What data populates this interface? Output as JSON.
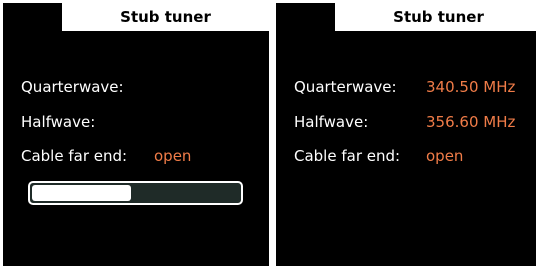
{
  "panels": [
    {
      "title": "Stub tuner",
      "rows": [
        {
          "label": "Quarterwave:",
          "value": ""
        },
        {
          "label": "Halfwave:",
          "value": ""
        },
        {
          "label": "Cable far end:",
          "value": "open"
        }
      ],
      "progress": 0.48
    },
    {
      "title": "Stub tuner",
      "rows": [
        {
          "label": "Quarterwave:",
          "value": "340.50 MHz"
        },
        {
          "label": "Halfwave:",
          "value": "356.60 MHz"
        },
        {
          "label": "Cable far end:",
          "value": "open"
        }
      ]
    }
  ],
  "colors": {
    "background": "#000000",
    "text": "#ffffff",
    "accent": "#f07c48",
    "progress_track": "#1f2b28"
  }
}
